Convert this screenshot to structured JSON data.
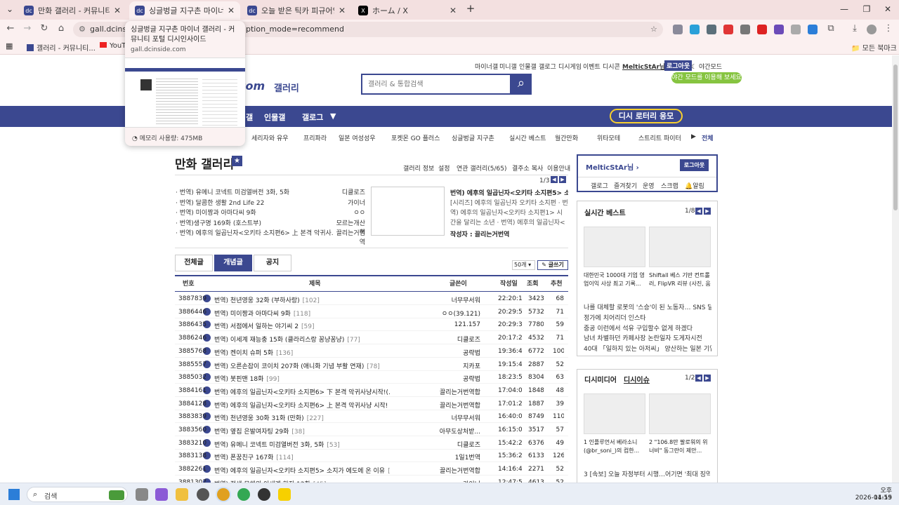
{
  "browser": {
    "tabs": [
      {
        "label": "만화 갤러리 - 커뮤니티 포털 D",
        "active": false
      },
      {
        "label": "싱글벙글 지구촌 마이너 갤러리 -",
        "active": true
      },
      {
        "label": "오늘 받은 틱카 피규어임... -",
        "active": false
      },
      {
        "label": "ホーム / X",
        "active": false
      }
    ],
    "url_left": "gall.dcinside",
    "url_right": "ption_mode=recommend",
    "bookmarks": [
      "갤러리 - 커뮤니티...",
      "YouTu"
    ],
    "all_bookmarks": "모든 북마크"
  },
  "tooltip": {
    "title": "싱글벙글 지구촌 마이너 갤러리 - 커뮤니티 포털 디시인사이드",
    "domain": "gall.dcinside.com",
    "memory": "메모리 사용량: 475MB"
  },
  "header": {
    "top_links": [
      "마이너갤",
      "미니갤",
      "인물갤",
      "갤로그",
      "디시게임",
      "이벤트",
      "디시콘"
    ],
    "user": "MelticStAr님",
    "logout": "로그아웃",
    "night": "야간모드",
    "night_hint": "야간 모드를 이용해 보세요",
    "logo": "com",
    "logo_sub": "갤러리",
    "search_placeholder": "갤러리 & 통합검색",
    "nav": [
      "갤",
      "인물갤",
      "갤로그"
    ],
    "lotto": "디시 로터리 응모",
    "subnav": [
      "세리자와 유우",
      "프리파라",
      "일본 여성성우",
      "포켓몬 GO 플러스",
      "싱글벙글 지구촌",
      "실시간 베스트",
      "월간만화",
      "위타모테",
      "스트리트 파이터",
      "전체"
    ]
  },
  "gallery": {
    "title": "만화 갤러리",
    "links": [
      "갤러리 정보",
      "설정",
      "연관 갤러리(5/65)",
      "결주소 복사",
      "이용안내"
    ],
    "pager": "1/3",
    "news": [
      {
        "t": "· 번역) 유메니 코넥트 미검열버전 3화, 5화",
        "a": "디클로즈"
      },
      {
        "t": "· 번역) 달콤한 생활 2nd Life 22",
        "a": "가이너"
      },
      {
        "t": "· 번역) 미이짱과 아마다씨 9화",
        "a": "ㅇㅇ"
      },
      {
        "t": "· 번역)생구명 169화 (호스트부)",
        "a": "모르는개산책"
      },
      {
        "t": "· 번역) 에후의 일곱닌자<오키타 소지편6> 上 본격 악귀사...",
        "a": "끌리는거번역"
      }
    ],
    "feature": {
      "title": "번역) 에후의 일곱닌자<오키타 소지편5> 소지...",
      "desc": "[시리즈] 에후의 일곱닌자 오키타 소지편 · 번역) 에후의 일곱닌자<오키타 소지편1> 시간을 달리는 소년 · 번역) 에후의 일곱닌자<오키타 소지편2>",
      "author": "작성자 : 끌리는거번역"
    },
    "tabs": [
      "전체글",
      "개념글",
      "공지"
    ],
    "per_page": "50개",
    "write": "글쓰기",
    "cols": [
      "번호",
      "제목",
      "글쓴이",
      "작성일",
      "조회",
      "추천"
    ],
    "rows": [
      {
        "n": "3887839",
        "t": "번역) 천년영웅 32화 (부하사랑)",
        "c": "[102]",
        "w": "너무무서워",
        "d": "22:20:11",
        "v": "3423",
        "r": "68"
      },
      {
        "n": "3886446",
        "t": "번역) 미이짱과 아마다씨 9화",
        "c": "[118]",
        "w": "ㅇㅇ(39.121)",
        "d": "20:29:59",
        "v": "5732",
        "r": "71"
      },
      {
        "n": "3886435",
        "t": "번역) 서점에서 일하는 야기씨 2",
        "c": "[59]",
        "w": "121.157",
        "d": "20:29:30",
        "v": "7780",
        "r": "59"
      },
      {
        "n": "3886246",
        "t": "번역) 이세계 재능충 15화 (클라리스랑 꽁냥꽁냥)",
        "c": "[77]",
        "w": "디클로즈",
        "d": "20:17:25",
        "v": "4532",
        "r": "71"
      },
      {
        "n": "3885768",
        "t": "번역) 켄이치 슈퍼 5화",
        "c": "[136]",
        "w": "공략법",
        "d": "19:36:47",
        "v": "6772",
        "r": "100"
      },
      {
        "n": "3885557",
        "t": "번역) 오른손잡이 코이치 207화 (애니화 기념 부활 연재)",
        "c": "[78]",
        "w": "지카포",
        "d": "19:15:48",
        "v": "2887",
        "r": "52"
      },
      {
        "n": "3885032",
        "t": "번역) 봇핀맨 18화",
        "c": "[99]",
        "w": "공략법",
        "d": "18:23:58",
        "v": "8304",
        "r": "63"
      },
      {
        "n": "3884161",
        "t": "번역) 에후의 일곱닌자<오키타 소지편6> 下 본격 악귀사냥시작!(...",
        "c": "[51]",
        "w": "끌리는거번역합",
        "d": "17:04:06",
        "v": "1848",
        "r": "48"
      },
      {
        "n": "3884128",
        "t": "번역) 에후의 일곱닌자<오키타 소지편6> 上 본격 악귀사냥 시작!",
        "c": "[33]",
        "w": "끌리는거번역합",
        "d": "17:01:26",
        "v": "1887",
        "r": "39"
      },
      {
        "n": "3883839",
        "t": "번역) 천년영웅 30화 31화 (만화)",
        "c": "[227]",
        "w": "너무무서워",
        "d": "16:40:04",
        "v": "8749",
        "r": "110"
      },
      {
        "n": "3883560",
        "t": "번역) 옆집 은발여자팅 29화",
        "c": "[38]",
        "w": "아무도상처받...",
        "d": "16:15:00",
        "v": "3517",
        "r": "57"
      },
      {
        "n": "3883210",
        "t": "번역) 유메니 코넥트 미검열버전 3화, 5화",
        "c": "[53]",
        "w": "디클로즈",
        "d": "15:42:25",
        "v": "6376",
        "r": "49"
      },
      {
        "n": "3883138",
        "t": "번역) 폰꿈친구 167화",
        "c": "[114]",
        "w": "1일1번역",
        "d": "15:36:21",
        "v": "6133",
        "r": "126"
      },
      {
        "n": "3882261",
        "t": "번역) 에후의 일곱닌자<오키타 소지편5> 소지가 에도에 온 이유",
        "c": "[51]",
        "w": "끌리는거번역합",
        "d": "14:16:46",
        "v": "2271",
        "r": "52"
      },
      {
        "n": "3881307",
        "t": "번역) 정생 무해의 이세계 하자 12화",
        "c": "[45]",
        "w": "가이너",
        "d": "12:47:51",
        "v": "4613",
        "r": "52"
      }
    ]
  },
  "sidebar": {
    "user": "MelticStAr님",
    "logout": "로그아웃",
    "menu": [
      "갤로그",
      "즐겨찾기",
      "운영",
      "스크랩",
      "알림"
    ],
    "best_title": "실시간 베스트",
    "best_pager": "1/8",
    "best_caps": [
      "대한민국 1000대 기업 영업이익 사상 최고 기록...하",
      "Shiftall 베스 기반 컨트롤러, FlipVR 리뷰 (사진, 움"
    ],
    "best_list": [
      "나를 대체할 로봇의 '스승'이 된 노동자… SNS 달군 …",
      "정가에 치어리더 인스타",
      "중공 이런에서 석유 구입할수 없게 하겠다",
      "남녀 차별하던 카페사장 논란일자 도게자시전",
      "40대 「일하지 있는 아저씨」 양산하는 일본 기업의 …"
    ],
    "media_title": "디시미디어",
    "issue_title": "디시이슈",
    "media_pager": "1/2",
    "media_caps": [
      "1 인플루언서 베라소니(@br_soni_)의 컴한...",
      "2 \"106.8만 팔로워의 위너비\" 동그란이 제안..."
    ],
    "media_list": [
      "3 [속보] 오늘 자정부터 시행…어기면 '최대 징역 3년'"
    ]
  },
  "taskbar": {
    "search": "검색",
    "time": "오후 11:59",
    "date": "2026-04-15"
  }
}
